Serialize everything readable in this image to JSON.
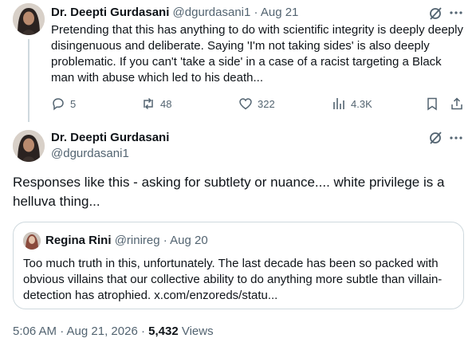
{
  "tweet1": {
    "author_name": "Dr. Deepti Gurdasani",
    "author_handle": "@dgurdasani1",
    "separator": "·",
    "date": "Aug 21",
    "text": "Pretending that this has anything to do with scientific integrity is deeply deeply disingenuous and deliberate. Saying 'I'm not taking sides' is also deeply problematic. If you can't 'take a side' in a case of a racist targeting a Black man with abuse which led to his death...",
    "replies": "5",
    "reposts": "48",
    "likes": "322",
    "views": "4.3K"
  },
  "tweet2": {
    "author_name": "Dr. Deepti Gurdasani",
    "author_handle": "@dgurdasani1",
    "text": "Responses like this - asking for subtlety or nuance.... white privilege is a helluva thing...",
    "timestamp": "5:06 AM · Aug 21, 2026 · ",
    "views_count": "5,432",
    "views_label": " Views"
  },
  "quote": {
    "author_name": "Regina Rini",
    "author_handle": "@rinireg",
    "separator": "·",
    "date": "Aug 20",
    "text": "Too much truth in this, unfortunately. The last decade has been so packed with obvious villains that our collective ability to do anything more subtle than villain-detection has atrophied. x.com/enzoreds/statu..."
  },
  "icons": {
    "grok": "grok-icon",
    "more": "more-horizontal-icon",
    "reply": "reply-icon",
    "repost": "repost-icon",
    "like": "heart-icon",
    "views": "analytics-icon",
    "bookmark": "bookmark-icon",
    "share": "share-icon"
  },
  "colors": {
    "text": "#0f1419",
    "muted": "#536471",
    "border": "#cfd9de"
  }
}
